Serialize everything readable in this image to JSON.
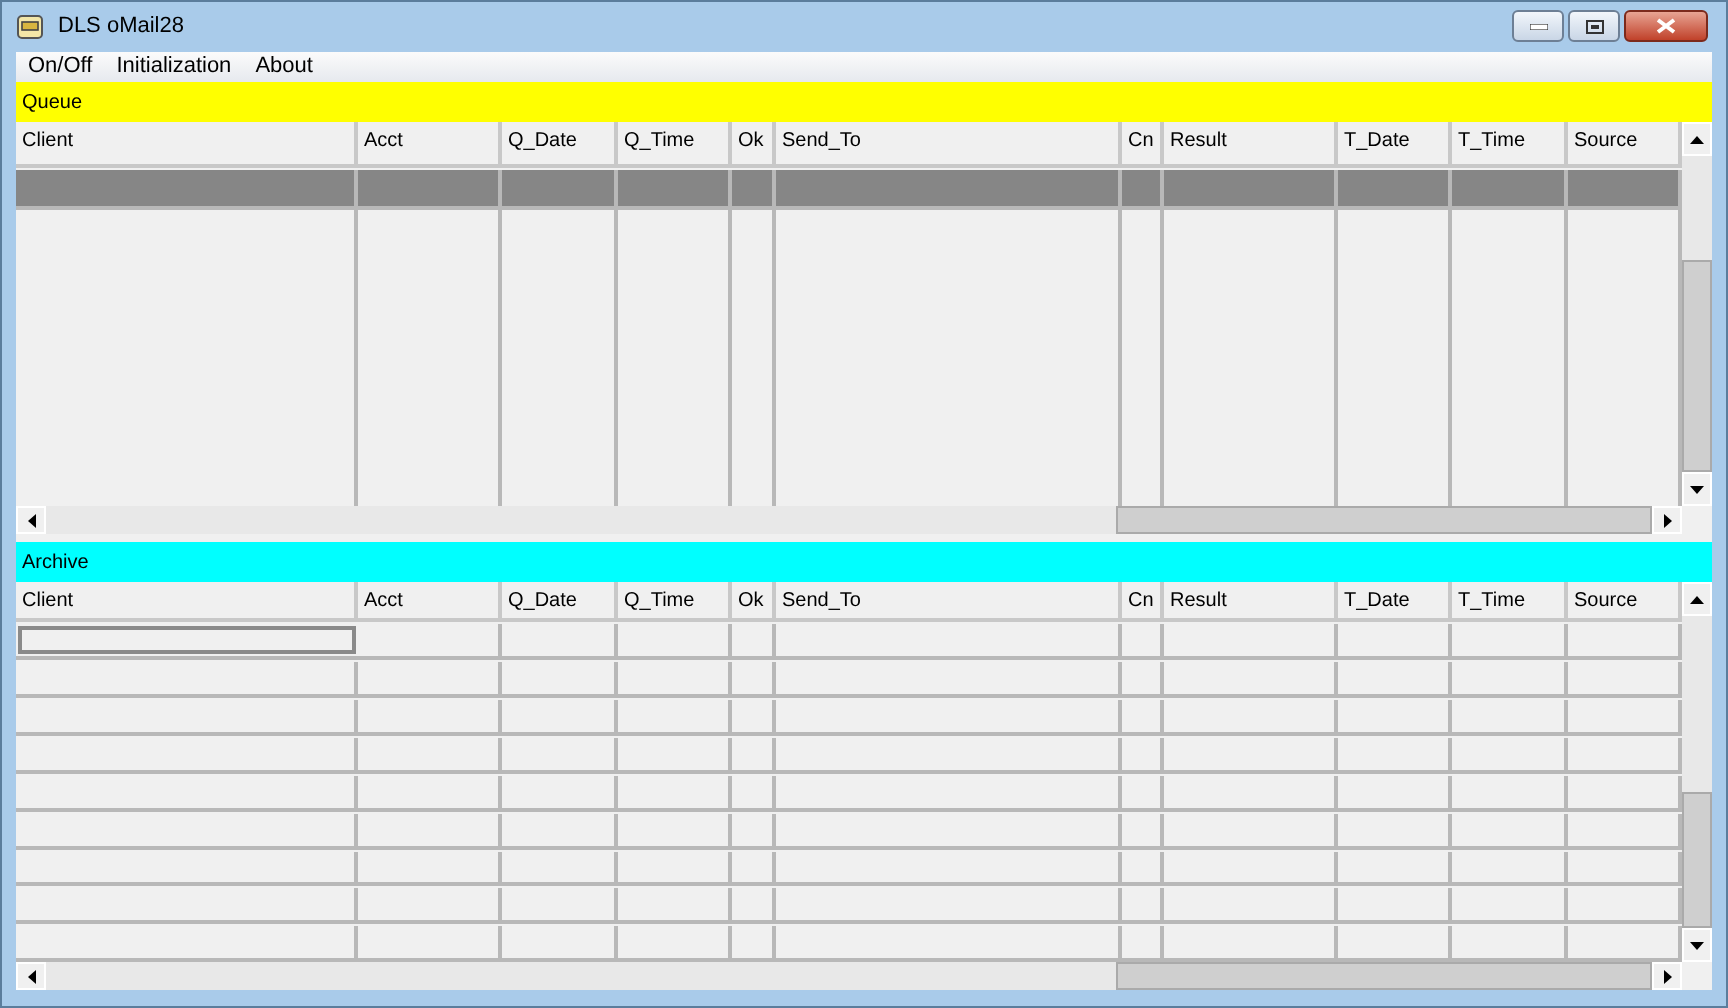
{
  "window": {
    "title": "DLS oMail28"
  },
  "menu": [
    {
      "label": "On/Off"
    },
    {
      "label": "Initialization"
    },
    {
      "label": "About"
    }
  ],
  "queue": {
    "title": "Queue",
    "columns": [
      "Client",
      "Acct",
      "Q_Date",
      "Q_Time",
      "Ok",
      "Send_To",
      "Cn",
      "Result",
      "T_Date",
      "T_Time",
      "Source"
    ],
    "rows": [
      {
        "selected": true,
        "focused": false
      }
    ]
  },
  "archive": {
    "title": "Archive",
    "columns": [
      "Client",
      "Acct",
      "Q_Date",
      "Q_Time",
      "Ok",
      "Send_To",
      "Cn",
      "Result",
      "T_Date",
      "T_Time",
      "Source"
    ],
    "rows": [
      {
        "selected": false,
        "focused": true
      },
      {
        "selected": false,
        "focused": false
      },
      {
        "selected": false,
        "focused": false
      },
      {
        "selected": false,
        "focused": false
      },
      {
        "selected": false,
        "focused": false
      },
      {
        "selected": false,
        "focused": false
      },
      {
        "selected": false,
        "focused": false
      },
      {
        "selected": false,
        "focused": false
      },
      {
        "selected": false,
        "focused": false
      }
    ]
  }
}
